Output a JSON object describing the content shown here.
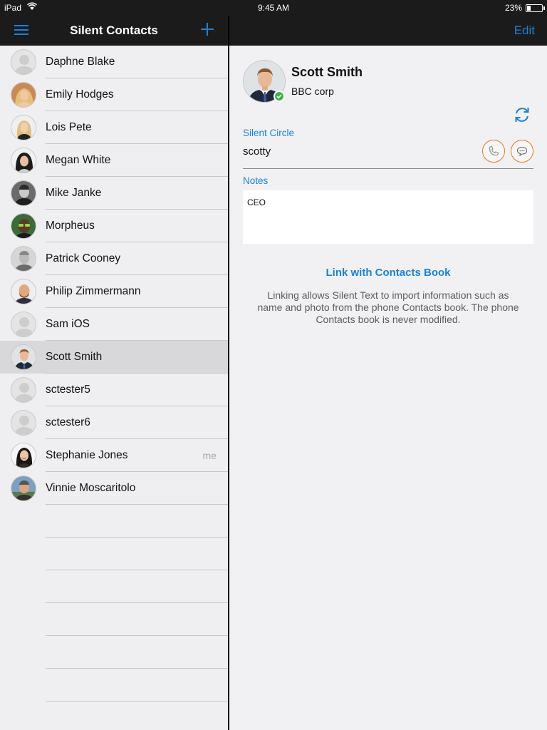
{
  "status_bar": {
    "device": "iPad",
    "time": "9:45 AM",
    "battery_percent": "23%",
    "battery_level": 0.23
  },
  "left_pane": {
    "title": "Silent Contacts",
    "menu_icon": "hamburger-menu-icon",
    "add_icon": "plus-icon",
    "contacts": [
      {
        "name": "Daphne Blake",
        "avatar": "placeholder",
        "selected": false,
        "tag": ""
      },
      {
        "name": "Emily Hodges",
        "avatar": "photo-blonde-woman",
        "selected": false,
        "tag": ""
      },
      {
        "name": "Lois Pete",
        "avatar": "photo-blonde-woman-dark-top",
        "selected": false,
        "tag": ""
      },
      {
        "name": "Megan White",
        "avatar": "photo-dark-hair-woman",
        "selected": false,
        "tag": ""
      },
      {
        "name": "Mike Janke",
        "avatar": "photo-man-bw",
        "selected": false,
        "tag": ""
      },
      {
        "name": "Morpheus",
        "avatar": "photo-man-sunglasses",
        "selected": false,
        "tag": ""
      },
      {
        "name": "Patrick Cooney",
        "avatar": "photo-man-gray",
        "selected": false,
        "tag": ""
      },
      {
        "name": "Philip Zimmermann",
        "avatar": "photo-man-beard",
        "selected": false,
        "tag": ""
      },
      {
        "name": "Sam iOS",
        "avatar": "placeholder",
        "selected": false,
        "tag": ""
      },
      {
        "name": "Scott Smith",
        "avatar": "photo-man-suit",
        "selected": true,
        "tag": ""
      },
      {
        "name": "sctester5",
        "avatar": "placeholder",
        "selected": false,
        "tag": ""
      },
      {
        "name": "sctester6",
        "avatar": "placeholder",
        "selected": false,
        "tag": ""
      },
      {
        "name": "Stephanie Jones",
        "avatar": "photo-dark-hair-woman-smile",
        "selected": false,
        "tag": "me"
      },
      {
        "name": "Vinnie Moscaritolo",
        "avatar": "photo-man-outdoor",
        "selected": false,
        "tag": ""
      }
    ]
  },
  "detail": {
    "edit_label": "Edit",
    "name": "Scott Smith",
    "company": "BBC corp",
    "online_icon": "check-icon",
    "refresh_icon": "refresh-icon",
    "silent_circle_label": "Silent Circle",
    "username": "scotty",
    "call_icon": "phone-icon",
    "message_icon": "chat-bubble-icon",
    "notes_label": "Notes",
    "notes": "CEO",
    "link_label": "Link with Contacts Book",
    "link_description": "Linking allows Silent Text to import information such as name and photo from the phone Contacts book. The phone Contacts book is never modified."
  },
  "colors": {
    "accent": "#1a82d8",
    "orange": "#e77918",
    "online": "#3db048",
    "nav_bg": "#1b1b1b",
    "list_bg": "#efeff1",
    "selected_row": "#d8d8da"
  }
}
